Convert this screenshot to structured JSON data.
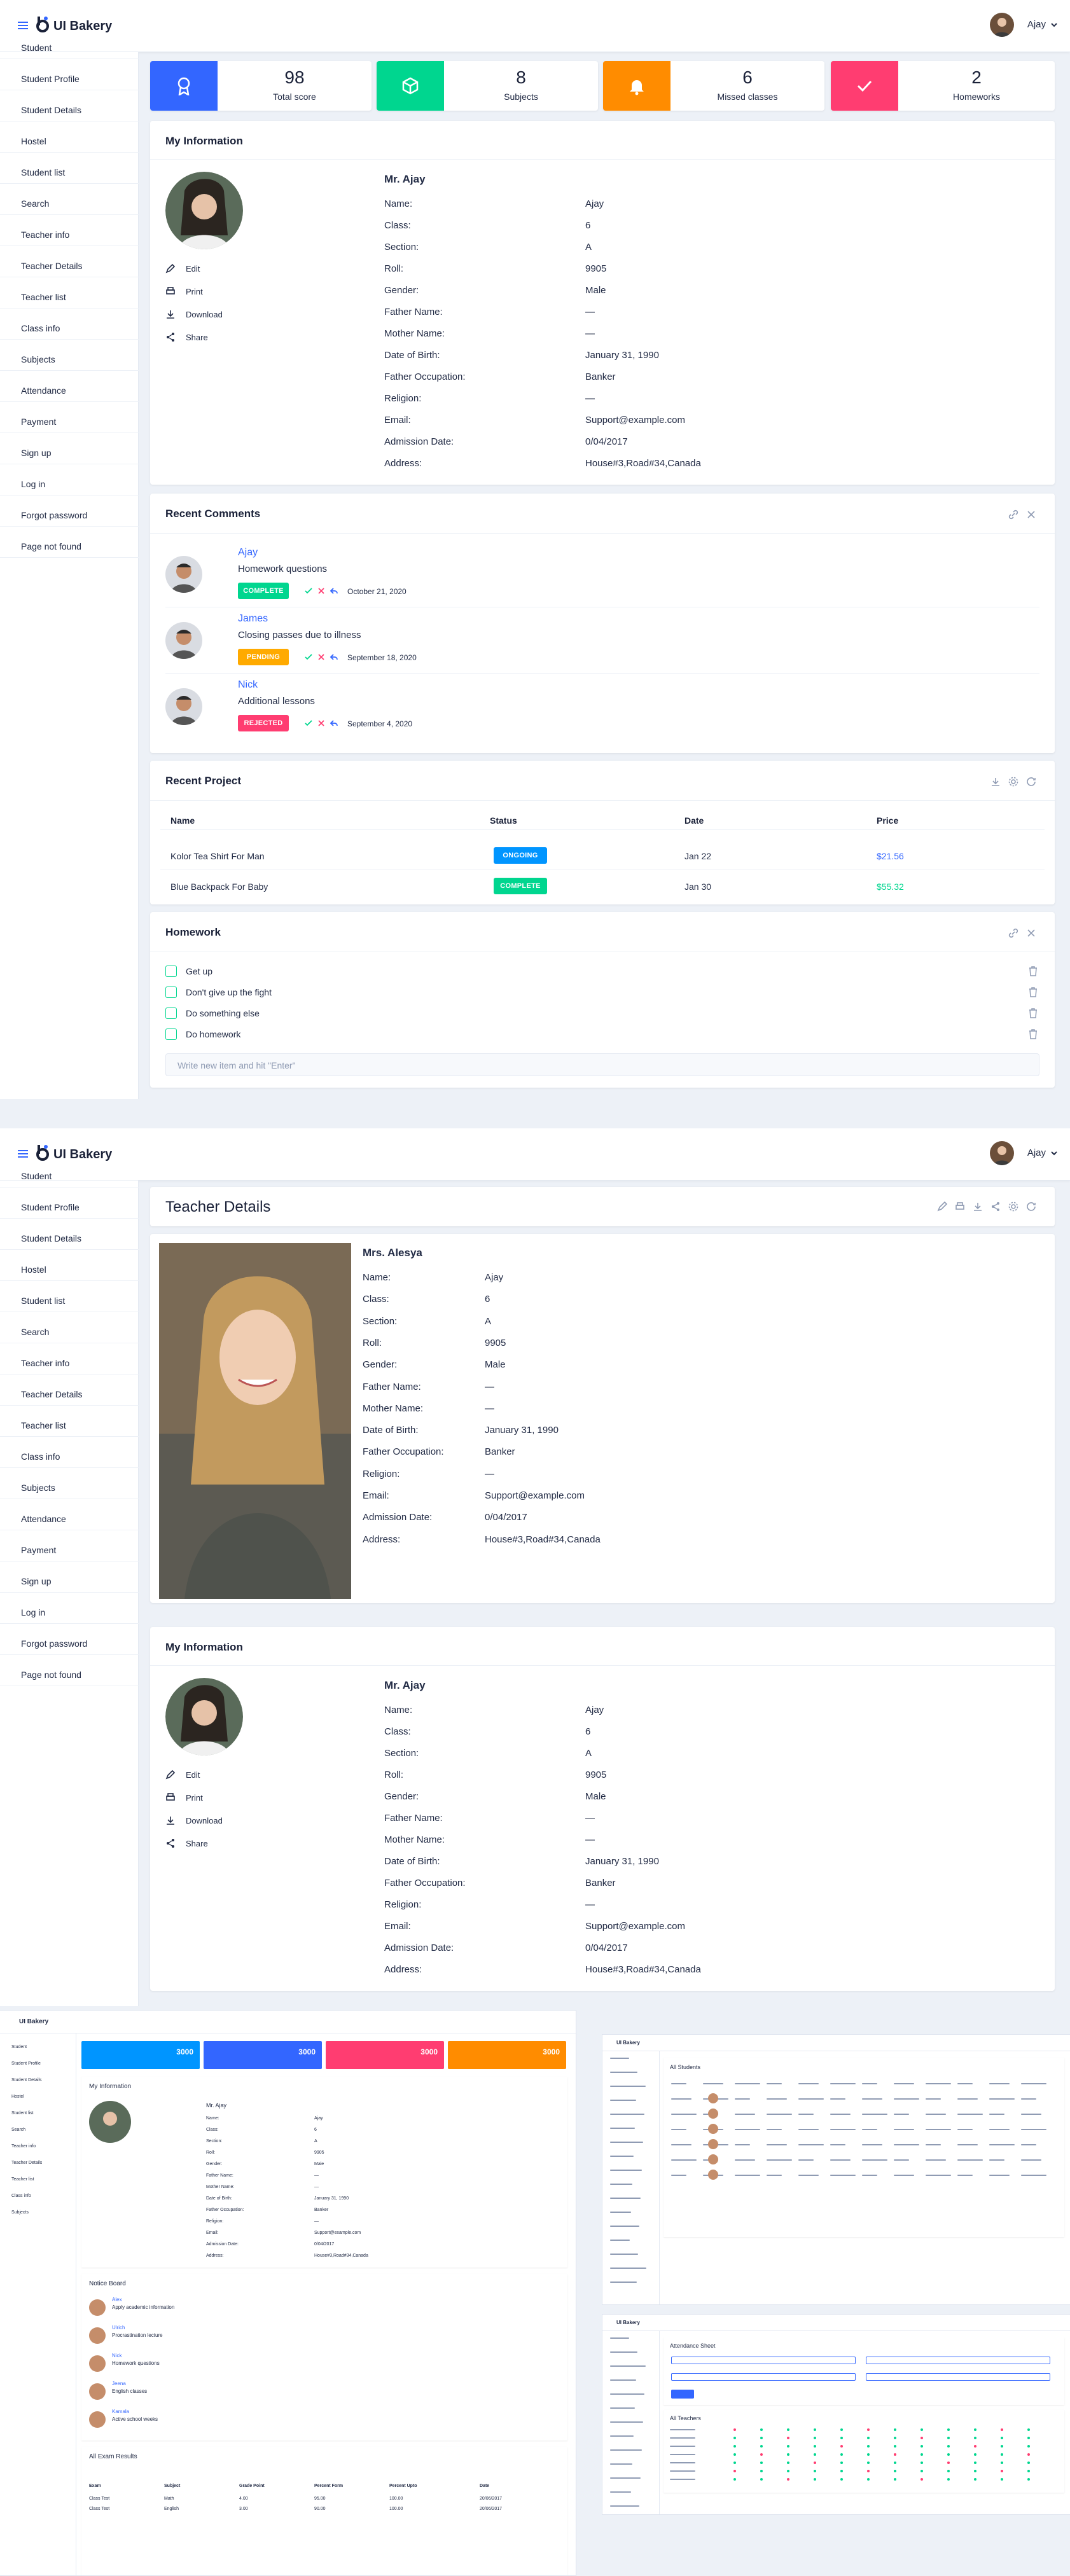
{
  "app": {
    "name": "UI Bakery",
    "user": "Ajay"
  },
  "sidebar": [
    "Student",
    "Student Profile",
    "Student Details",
    "Hostel",
    "Student list",
    "Search",
    "Teacher info",
    "Teacher Details",
    "Teacher list",
    "Class info",
    "Subjects",
    "Attendance",
    "Payment",
    "Sign up",
    "Log in",
    "Forgot password",
    "Page not found"
  ],
  "stats": [
    {
      "value": "98",
      "label": "Total score",
      "color": "#3366ff",
      "icon": "award-icon"
    },
    {
      "value": "8",
      "label": "Subjects",
      "color": "#00d68f",
      "icon": "cube-icon"
    },
    {
      "value": "6",
      "label": "Missed classes",
      "color": "#ff8c00",
      "icon": "bell-icon"
    },
    {
      "value": "2",
      "label": "Homeworks",
      "color": "#ff3d71",
      "icon": "check-icon"
    }
  ],
  "my_info": {
    "title": "My Information",
    "name": "Mr. Ajay",
    "actions": [
      "Edit",
      "Print",
      "Download",
      "Share"
    ],
    "fields": [
      {
        "label": "Name:",
        "value": "Ajay"
      },
      {
        "label": "Class:",
        "value": "6"
      },
      {
        "label": "Section:",
        "value": "A"
      },
      {
        "label": "Roll:",
        "value": "9905"
      },
      {
        "label": "Gender:",
        "value": "Male"
      },
      {
        "label": "Father Name:",
        "value": "—"
      },
      {
        "label": "Mother Name:",
        "value": "—"
      },
      {
        "label": "Date of Birth:",
        "value": "January 31, 1990"
      },
      {
        "label": "Father Occupation:",
        "value": "Banker"
      },
      {
        "label": "Religion:",
        "value": "—"
      },
      {
        "label": "Email:",
        "value": "Support@example.com"
      },
      {
        "label": "Admission Date:",
        "value": "0/04/2017"
      },
      {
        "label": "Address:",
        "value": "House#3,Road#34,Canada"
      }
    ]
  },
  "comments": {
    "title": "Recent Comments",
    "items": [
      {
        "name": "Ajay",
        "text": "Homework questions",
        "status": "COMPLETE",
        "color": "#00d68f",
        "date": "October 21, 2020"
      },
      {
        "name": "James",
        "text": "Closing passes due to illness",
        "status": "PENDING",
        "color": "#ffaa00",
        "date": "September 18, 2020"
      },
      {
        "name": "Nick",
        "text": "Additional lessons",
        "status": "REJECTED",
        "color": "#ff3d71",
        "date": "September 4, 2020"
      }
    ]
  },
  "project": {
    "title": "Recent Project",
    "headers": [
      "Name",
      "Status",
      "Date",
      "Price"
    ],
    "rows": [
      {
        "name": "Kolor Tea Shirt For Man",
        "status": "ONGOING",
        "color": "#0095ff",
        "date": "Jan 22",
        "price": "$21.56",
        "pcolor": "#3366ff"
      },
      {
        "name": "Blue Backpack For Baby",
        "status": "COMPLETE",
        "color": "#00d68f",
        "date": "Jan 30",
        "price": "$55.32",
        "pcolor": "#00d68f"
      }
    ]
  },
  "homework": {
    "title": "Homework",
    "tasks": [
      "Get up",
      "Don't give up the fight",
      "Do something else",
      "Do homework"
    ],
    "placeholder": "Write new item and hit \"Enter\""
  },
  "teacher": {
    "title": "Teacher Details",
    "name": "Mrs. Alesya",
    "fields": [
      {
        "label": "Name:",
        "value": "Ajay"
      },
      {
        "label": "Class:",
        "value": "6"
      },
      {
        "label": "Section:",
        "value": "A"
      },
      {
        "label": "Roll:",
        "value": "9905"
      },
      {
        "label": "Gender:",
        "value": "Male"
      },
      {
        "label": "Father Name:",
        "value": "—"
      },
      {
        "label": "Mother Name:",
        "value": "—"
      },
      {
        "label": "Date of Birth:",
        "value": "January 31, 1990"
      },
      {
        "label": "Father Occupation:",
        "value": "Banker"
      },
      {
        "label": "Religion:",
        "value": "—"
      },
      {
        "label": "Email:",
        "value": "Support@example.com"
      },
      {
        "label": "Admission Date:",
        "value": "0/04/2017"
      },
      {
        "label": "Address:",
        "value": "House#3,Road#34,Canada"
      }
    ]
  },
  "mini_a": {
    "stats": [
      {
        "value": "3000",
        "color": "#0095ff"
      },
      {
        "value": "3000",
        "color": "#3366ff"
      },
      {
        "value": "3000",
        "color": "#ff3d71"
      },
      {
        "value": "3000",
        "color": "#ff8c00"
      }
    ],
    "my_info": "My Information",
    "name": "Mr. Ajay",
    "notice": "Notice Board",
    "notices": [
      {
        "name": "Alex",
        "text": "Apply academic information"
      },
      {
        "name": "Ulrich",
        "text": "Procrastination lecture"
      },
      {
        "name": "Nick",
        "text": "Homework questions"
      },
      {
        "name": "Jeena",
        "text": "English classes"
      },
      {
        "name": "Kamala",
        "text": "Active school weeks"
      }
    ],
    "exams": "All Exam Results",
    "exam_headers": [
      "Exam",
      "Subject",
      "Grade Point",
      "Percent Form",
      "Percent Upto",
      "Date"
    ],
    "exam_rows": [
      [
        "Class Test",
        "Math",
        "4.00",
        "95.00",
        "100.00",
        "20/06/2017"
      ],
      [
        "Class Test",
        "English",
        "3.00",
        "90.00",
        "100.00",
        "20/06/2017"
      ]
    ]
  },
  "mini_b": {
    "title": "All Students"
  },
  "mini_c": {
    "title": "Attendance Sheet",
    "sub": "All Teachers"
  }
}
